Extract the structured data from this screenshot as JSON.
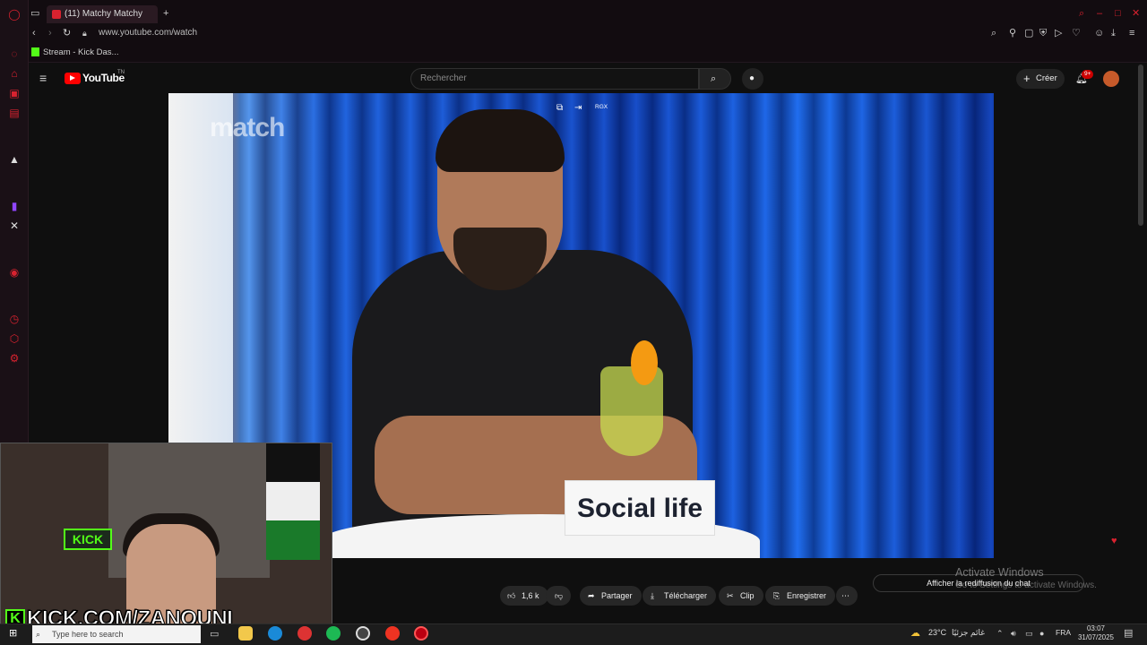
{
  "browser": {
    "tab_title": "(11) Matchy Matchy",
    "url": "www.youtube.com/watch",
    "bookmark": "Stream - Kick Das..."
  },
  "youtube": {
    "logo": "YouTube",
    "logo_suffix": "TN",
    "search_placeholder": "Rechercher",
    "create_label": "Créer",
    "notification_count": "9+"
  },
  "video": {
    "watermark": "match",
    "sign_text": "Social life",
    "overlay_label": "RGX"
  },
  "stream": {
    "kick_url": "KICK.COM/ZANOUNI",
    "neon_sign": "KICK"
  },
  "actions": {
    "likes": "1,6 k",
    "share": "Partager",
    "download": "Télécharger",
    "clip": "Clip",
    "save": "Enregistrer",
    "chat_replay": "Afficher la rediffusion du chat"
  },
  "watermark": {
    "activate_title": "Activate Windows",
    "activate_sub": "Go to Settings to activate Windows."
  },
  "taskbar": {
    "search_placeholder": "Type here to search",
    "temperature": "23°C",
    "weather_text": "غائم جزئيًا",
    "language": "FRA",
    "time": "03:07",
    "date": "31/07/2025"
  },
  "colors": {
    "opera_red": "#d8222f",
    "kick_green": "#53fc18",
    "yt_red": "#ff0000"
  }
}
